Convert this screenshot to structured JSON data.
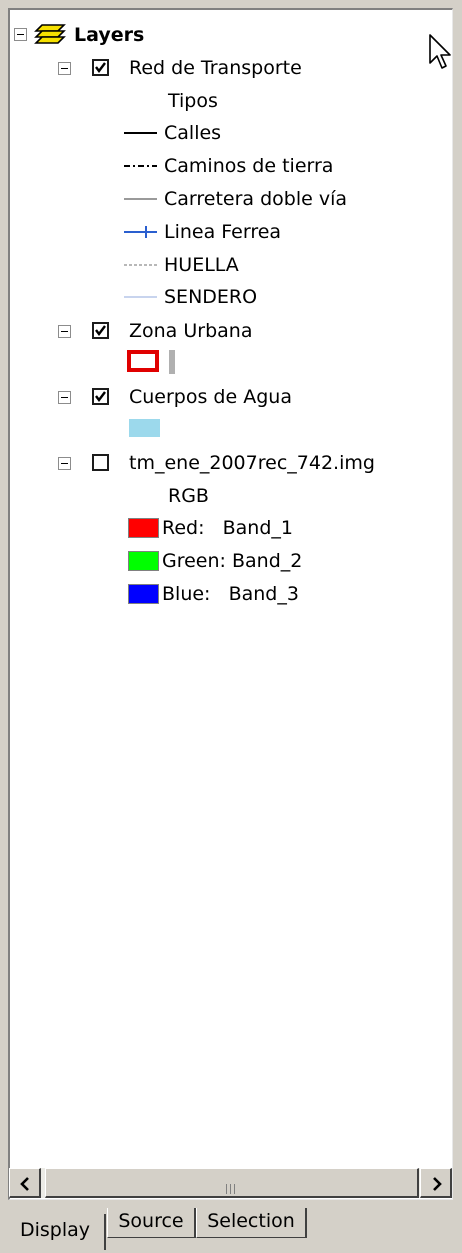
{
  "toc": {
    "root_label": "Layers",
    "layers": [
      {
        "name": "Red de Transporte",
        "checked": true,
        "legend_heading": "Tipos",
        "legend": [
          {
            "label": "Calles",
            "symbol": "solid-line",
            "color": "#000000"
          },
          {
            "label": "Caminos de tierra",
            "symbol": "dash-dot-line",
            "color": "#000000"
          },
          {
            "label": "Carretera doble vía",
            "symbol": "solid-line",
            "color": "#9a9a9a"
          },
          {
            "label": "Linea Ferrea",
            "symbol": "railroad-line",
            "color": "#2a5fcf"
          },
          {
            "label": "HUELLA",
            "symbol": "dotted-line",
            "color": "#b8b8b8"
          },
          {
            "label": "SENDERO",
            "symbol": "solid-line",
            "color": "#c8d4ee"
          }
        ]
      },
      {
        "name": "Zona Urbana",
        "checked": true,
        "legend": [
          {
            "label": "",
            "symbol": "outline-box",
            "color": "#e00000"
          }
        ]
      },
      {
        "name": "Cuerpos de Agua",
        "checked": true,
        "legend": [
          {
            "label": "",
            "symbol": "fill-box",
            "color": "#9cd9ec"
          }
        ]
      },
      {
        "name": "tm_ene_2007rec_742.img",
        "checked": false,
        "legend_heading": "RGB",
        "legend": [
          {
            "label": "Red:   Band_1",
            "symbol": "fill-box",
            "color": "#ff0000"
          },
          {
            "label": "Green: Band_2",
            "symbol": "fill-box",
            "color": "#00ff00"
          },
          {
            "label": "Blue:   Band_3",
            "symbol": "fill-box",
            "color": "#0000ff"
          }
        ]
      }
    ]
  },
  "tabs": [
    {
      "label": "Display",
      "active": true
    },
    {
      "label": "Source",
      "active": false
    },
    {
      "label": "Selection",
      "active": false
    }
  ],
  "icons": {
    "root": "layers-stack-icon",
    "cursor": "mouse-pointer-icon",
    "scroll_left": "arrow-left-icon",
    "scroll_right": "arrow-right-icon"
  }
}
